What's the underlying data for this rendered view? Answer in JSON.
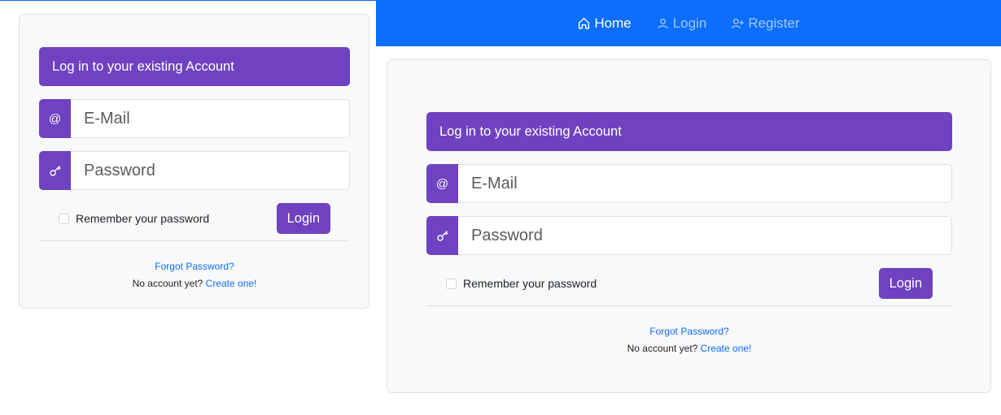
{
  "nav": {
    "home": "Home",
    "login": "Login",
    "register": "Register"
  },
  "form": {
    "header": "Log in to your existing Account",
    "email_placeholder": "E-Mail",
    "password_placeholder": "Password",
    "remember": "Remember your password",
    "login_button": "Login",
    "forgot": "Forgot Password?",
    "no_account": "No account yet?",
    "create": "Create one!"
  },
  "icons": {
    "email_addon": "@",
    "home": "house-icon",
    "login": "person-icon",
    "register": "person-plus-icon",
    "password": "key-icon"
  },
  "colors": {
    "accent": "#6f42c1",
    "navbar": "#0d6efd",
    "link": "#0d6efd"
  }
}
